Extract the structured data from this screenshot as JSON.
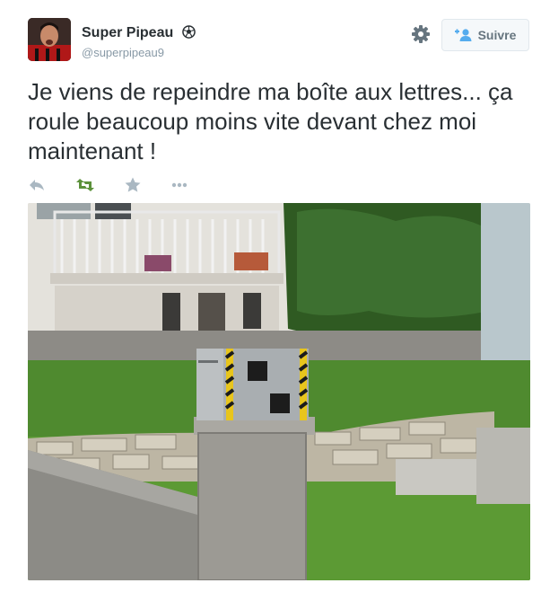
{
  "tweet": {
    "display_name": "Super Pipeau",
    "username": "@superpipeau9",
    "text": "Je viens de repeindre ma boîte aux lettres... ça roule beaucoup moins vite devant chez moi maintenant !",
    "follow_label": "Suivre"
  },
  "icons": {
    "verified": "soccer-ball-icon",
    "settings": "gear-icon",
    "follow": "add-user-icon",
    "reply": "reply-icon",
    "retweet": "retweet-icon",
    "favorite": "star-icon",
    "more": "more-icon"
  },
  "colors": {
    "text": "#292f33",
    "muted": "#8899a6",
    "retweet_green": "#5c913b",
    "follow_blue": "#55acee",
    "button_bg": "#f5f8fa",
    "button_border": "#e1e8ed"
  }
}
